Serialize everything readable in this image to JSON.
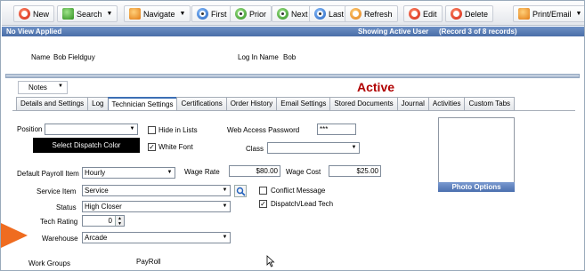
{
  "toolbar": {
    "new": "New",
    "search": "Search",
    "navigate": "Navigate",
    "first": "First",
    "prior": "Prior",
    "next": "Next",
    "last": "Last",
    "refresh": "Refresh",
    "edit": "Edit",
    "delete": "Delete",
    "print": "Print/Email"
  },
  "status": {
    "left": "No View Applied",
    "showing": "Showing Active User",
    "record": "(Record 3 of 8 records)"
  },
  "header": {
    "name_label": "Name",
    "name_value": "Bob Fieldguy",
    "login_label": "Log In Name",
    "login_value": "Bob"
  },
  "notes": "Notes",
  "state": "Active",
  "tabs": [
    "Details and Settings",
    "Log",
    "Technician Settings",
    "Certifications",
    "Order History",
    "Email Settings",
    "Stored Documents",
    "Journal",
    "Activities",
    "Custom Tabs"
  ],
  "form": {
    "position_label": "Position",
    "position_value": "",
    "hide_in_lists": "Hide in Lists",
    "web_password_label": "Web Access Password",
    "web_password_value": "***",
    "dispatch_color": "Select Dispatch Color",
    "white_font": "White Font",
    "class_label": "Class",
    "class_value": "",
    "payroll_label": "Default Payroll Item",
    "payroll_value": "Hourly",
    "wage_rate_label": "Wage Rate",
    "wage_rate_value": "$80.00",
    "wage_cost_label": "Wage Cost",
    "wage_cost_value": "$25.00",
    "service_item_label": "Service Item",
    "service_item_value": "Service",
    "conflict_message": "Conflict Message",
    "status_label": "Status",
    "status_value": "High Closer",
    "dispatch_lead": "Dispatch/Lead Tech",
    "tech_rating_label": "Tech Rating",
    "tech_rating_value": "0",
    "warehouse_label": "Warehouse",
    "warehouse_value": "Arcade",
    "work_groups_label": "Work Groups",
    "payroll_group_label": "PayRoll"
  },
  "photo_options": "Photo Options",
  "colors": {
    "accent_orange": "#ef6c20",
    "status_bar": "#4a6ea8",
    "active_red": "#b00000"
  }
}
